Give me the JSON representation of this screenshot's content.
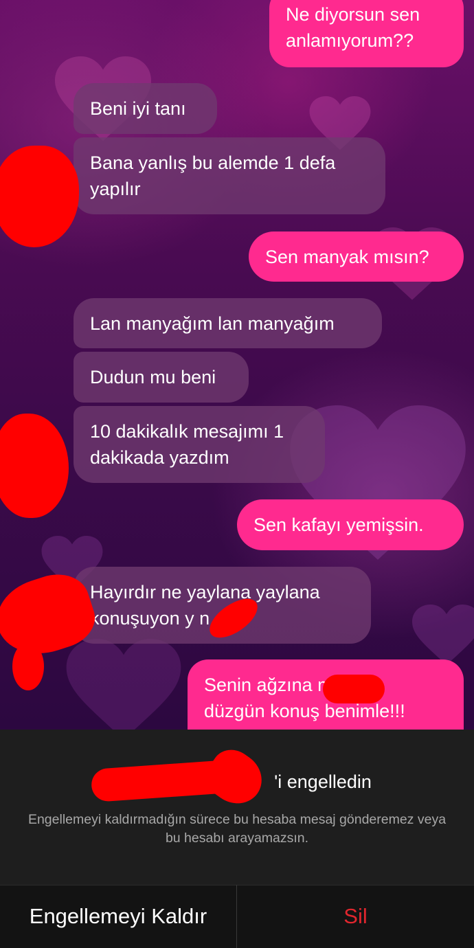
{
  "messages": [
    {
      "side": "out",
      "text": "Ne diyorsun sen\nanlamıyorum??"
    },
    {
      "side": "in",
      "text": "Beni iyi tanı"
    },
    {
      "side": "in",
      "text": "Bana yanlış bu alemde 1 defa\nyapılır"
    },
    {
      "side": "out",
      "text": "Sen manyak mısın?"
    },
    {
      "side": "in",
      "text": "Lan manyağım lan manyağım"
    },
    {
      "side": "in",
      "text": "Dudun mu beni"
    },
    {
      "side": "in",
      "text": "10 dakikalık mesajımı 1\ndakikada yazdım"
    },
    {
      "side": "out",
      "text": "Sen kafayı yemişsin."
    },
    {
      "side": "in",
      "text": "Hayırdır ne yaylana yaylana\nkonuşuyon y        n"
    },
    {
      "side": "out",
      "text": "Senin ağzına             m bak\ndüzgün konuş benimle!!!"
    }
  ],
  "blocked": {
    "title_suffix": "'i engelledin",
    "description": "Engellemeyi kaldırmadığın sürece bu hesaba mesaj gönderemez veya bu hesabı arayamazsın."
  },
  "actions": {
    "unblock_label": "Engellemeyi Kaldır",
    "delete_label": "Sil"
  },
  "colors": {
    "incoming_bubble": "#703a70",
    "outgoing_bubble": "#ff2a8f",
    "delete_text": "#e1262e",
    "redaction": "#ff0000"
  }
}
